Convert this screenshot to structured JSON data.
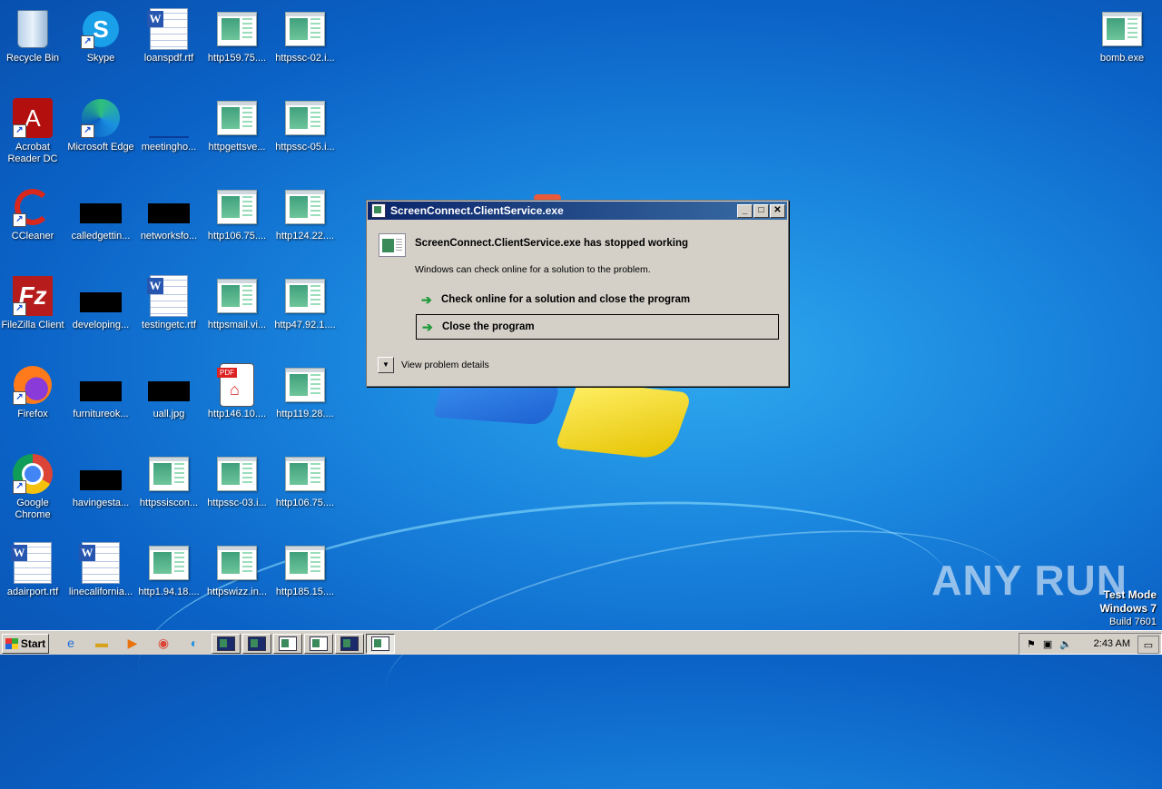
{
  "desktop": {
    "icons": [
      {
        "label": "Recycle Bin",
        "icon": "recycle-bin-icon"
      },
      {
        "label": "Skype",
        "icon": "skype-icon"
      },
      {
        "label": "loanspdf.rtf",
        "icon": "word-doc-icon"
      },
      {
        "label": "http159.75....",
        "icon": "html-file-icon"
      },
      {
        "label": "httpssc-02.i...",
        "icon": "html-file-icon"
      },
      {
        "label": "bomb.exe",
        "icon": "html-file-icon"
      },
      {
        "label": "Acrobat Reader DC",
        "icon": "acrobat-icon"
      },
      {
        "label": "Microsoft Edge",
        "icon": "edge-icon"
      },
      {
        "label": "meetingho...",
        "icon": "blank-file-icon"
      },
      {
        "label": "httpgettsve...",
        "icon": "html-file-icon"
      },
      {
        "label": "httpssc-05.i...",
        "icon": "html-file-icon"
      },
      {
        "label": "CCleaner",
        "icon": "ccleaner-icon"
      },
      {
        "label": "calledgettin...",
        "icon": "black-file-icon"
      },
      {
        "label": "networksfo...",
        "icon": "black-file-icon"
      },
      {
        "label": "http106.75....",
        "icon": "html-file-icon"
      },
      {
        "label": "http124.22....",
        "icon": "html-file-icon"
      },
      {
        "label": "FileZilla Client",
        "icon": "filezilla-icon"
      },
      {
        "label": "developing...",
        "icon": "black-file-icon"
      },
      {
        "label": "testingetc.rtf",
        "icon": "word-doc-icon"
      },
      {
        "label": "httpsmail.vi...",
        "icon": "html-file-icon"
      },
      {
        "label": "http47.92.1....",
        "icon": "html-file-icon"
      },
      {
        "label": "Firefox",
        "icon": "firefox-icon"
      },
      {
        "label": "furnitureok...",
        "icon": "black-file-icon"
      },
      {
        "label": "uall.jpg",
        "icon": "black-file-icon"
      },
      {
        "label": "http146.10....",
        "icon": "pdf-file-icon"
      },
      {
        "label": "http119.28....",
        "icon": "html-file-icon"
      },
      {
        "label": "Google Chrome",
        "icon": "chrome-icon"
      },
      {
        "label": "havingesta...",
        "icon": "black-file-icon"
      },
      {
        "label": "httpssiscon...",
        "icon": "html-file-icon"
      },
      {
        "label": "httpssc-03.i...",
        "icon": "html-file-icon"
      },
      {
        "label": "http106.75....",
        "icon": "html-file-icon"
      },
      {
        "label": "adairport.rtf",
        "icon": "word-doc-icon"
      },
      {
        "label": "linecalifornia...",
        "icon": "word-doc-icon"
      },
      {
        "label": "http1.94.18....",
        "icon": "html-file-icon"
      },
      {
        "label": "httpswizz.in...",
        "icon": "html-file-icon"
      },
      {
        "label": "http185.15....",
        "icon": "html-file-icon"
      }
    ]
  },
  "dialog": {
    "title": "ScreenConnect.ClientService.exe",
    "headline": "ScreenConnect.ClientService.exe has stopped working",
    "subtext": "Windows can check online for a solution to the problem.",
    "option1": "Check online for a solution and close the program",
    "option2": "Close the program",
    "details": "View problem details",
    "minimize": "_",
    "maximize": "□",
    "close": "✕"
  },
  "taskbar": {
    "start_label": "Start",
    "clock": "2:43 AM"
  },
  "watermark": {
    "text": "ANY RUN",
    "mode": "Test Mode",
    "os": "Windows 7",
    "build": "Build 7601"
  }
}
